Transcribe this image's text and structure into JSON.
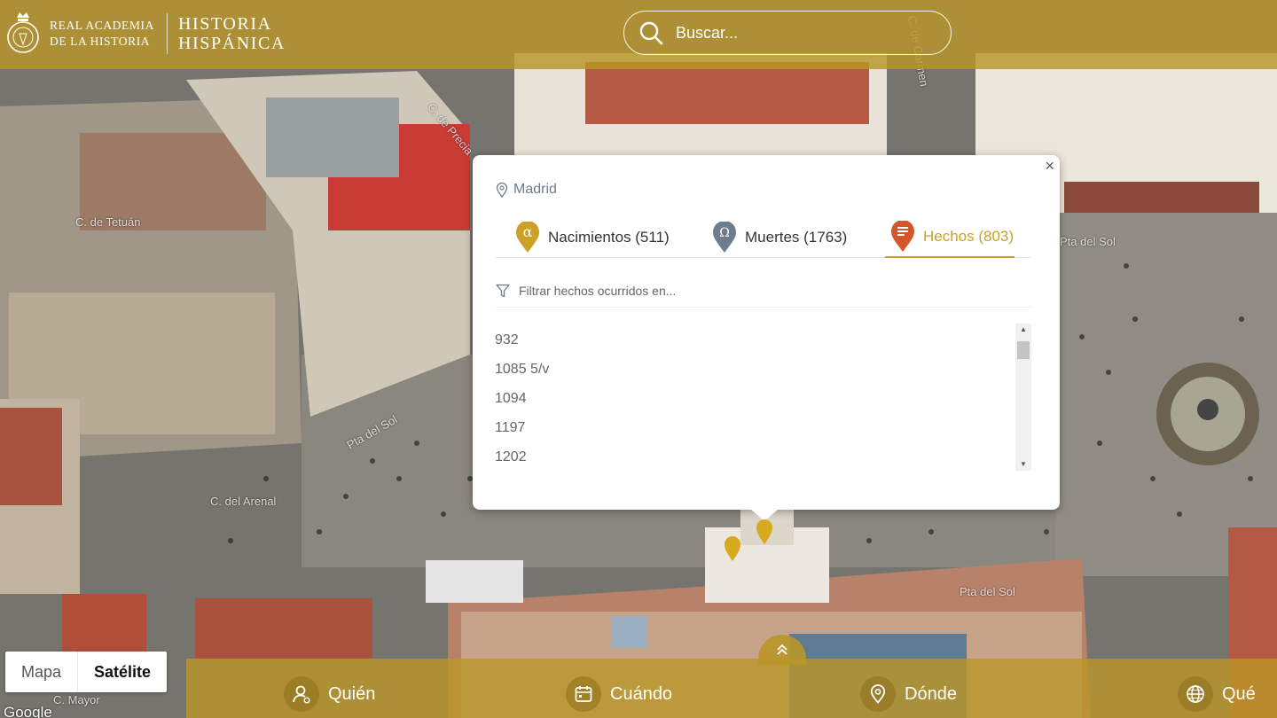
{
  "header": {
    "academy_line1": "REAL ACADEMIA",
    "academy_line2": "DE LA HISTORIA",
    "brand_line1": "HISTORIA",
    "brand_line2": "HISPÁNICA",
    "search_placeholder": "Buscar..."
  },
  "map": {
    "street_labels": [
      "C. de Tetuán",
      "C. de Precia",
      "C. del Arenal",
      "Pta del Sol",
      "Pta del Sol",
      "Pta del Sol",
      "C. Mayor",
      "C. de Carmen"
    ]
  },
  "popup": {
    "location": "Madrid",
    "tabs": [
      {
        "label": "Nacimientos (511)",
        "icon": "alpha-pin-icon",
        "color": "#c9a227"
      },
      {
        "label": "Muertes (1763)",
        "icon": "omega-pin-icon",
        "color": "#6e7d8c"
      },
      {
        "label": "Hechos (803)",
        "icon": "document-pin-icon",
        "color": "#d3572b",
        "active": true
      }
    ],
    "filter_placeholder": "Filtrar hechos ocurridos en...",
    "years": [
      "932",
      "1085 5/v",
      "1094",
      "1197",
      "1202"
    ],
    "close": "×"
  },
  "map_type": {
    "map_label": "Mapa",
    "satellite_label": "Satélite",
    "selected": "Satélite"
  },
  "attribution": "Google",
  "bottom_nav": {
    "who": "Quién",
    "when": "Cuándo",
    "where": "Dónde",
    "what": "Qué"
  },
  "colors": {
    "accent_gold": "#c9a227",
    "bar_gold": "#b99628",
    "fact_red": "#d3572b",
    "death_gray": "#6e7d8c"
  }
}
